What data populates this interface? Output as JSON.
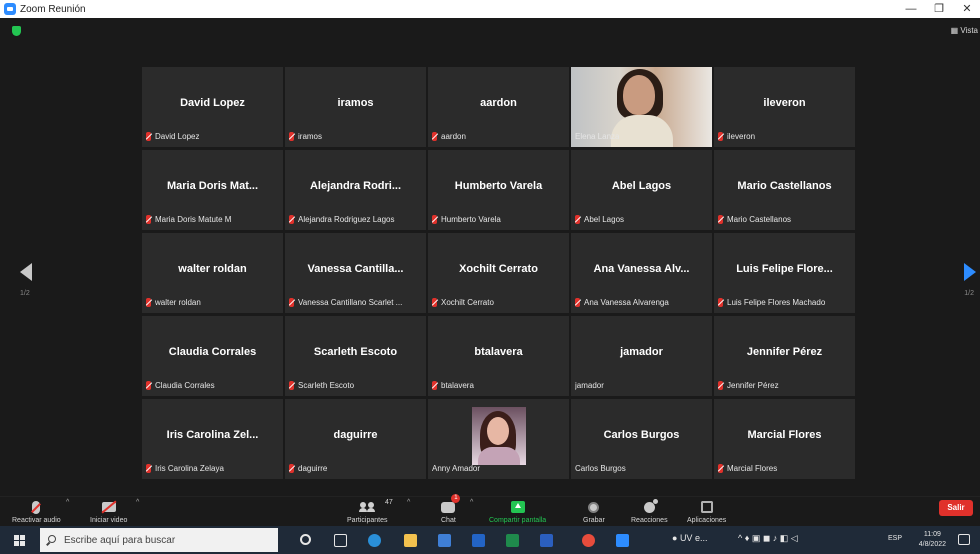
{
  "window": {
    "title": "Zoom Reunión",
    "minimize": "—",
    "maximize": "❐",
    "close": "✕"
  },
  "topbar": {
    "view_label": "Vista"
  },
  "pagination": {
    "left": "1/2",
    "right": "1/2"
  },
  "tiles": [
    {
      "big": "David Lopez",
      "label": "David Lopez",
      "muted": true
    },
    {
      "big": "iramos",
      "label": "iramos",
      "muted": true
    },
    {
      "big": "aardon",
      "label": "aardon",
      "muted": true
    },
    {
      "big": "",
      "label": "Elena Lanza",
      "muted": false,
      "video": "v1",
      "active": true
    },
    {
      "big": "ileveron",
      "label": "ileveron",
      "muted": true
    },
    {
      "big": "Maria Doris Mat...",
      "label": "Maria Doris Matute M",
      "muted": true
    },
    {
      "big": "Alejandra Rodri...",
      "label": "Alejandra Rodriguez Lagos",
      "muted": true
    },
    {
      "big": "Humberto Varela",
      "label": "Humberto Varela",
      "muted": true
    },
    {
      "big": "Abel Lagos",
      "label": "Abel Lagos",
      "muted": true
    },
    {
      "big": "Mario Castellanos",
      "label": "Mario Castellanos",
      "muted": true
    },
    {
      "big": "walter roldan",
      "label": "walter roldan",
      "muted": true
    },
    {
      "big": "Vanessa Cantilla...",
      "label": "Vanessa Cantillano Scarlet ...",
      "muted": true
    },
    {
      "big": "Xochilt Cerrato",
      "label": "Xochilt Cerrato",
      "muted": true
    },
    {
      "big": "Ana Vanessa Alv...",
      "label": "Ana Vanessa Alvarenga",
      "muted": true
    },
    {
      "big": "Luis Felipe Flore...",
      "label": "Luis Felipe Flores Machado",
      "muted": true
    },
    {
      "big": "Claudia Corrales",
      "label": "Claudia Corrales",
      "muted": true
    },
    {
      "big": "Scarleth Escoto",
      "label": "Scarleth Escoto",
      "muted": true
    },
    {
      "big": "btalavera",
      "label": "btalavera",
      "muted": true
    },
    {
      "big": "jamador",
      "label": "jamador",
      "muted": false
    },
    {
      "big": "Jennifer Pérez",
      "label": "Jennifer Pérez",
      "muted": true
    },
    {
      "big": "Iris Carolina Zel...",
      "label": "Iris Carolina Zelaya",
      "muted": true
    },
    {
      "big": "daguirre",
      "label": "daguirre",
      "muted": true
    },
    {
      "big": "",
      "label": "Anny Amador",
      "muted": false,
      "video": "v2"
    },
    {
      "big": "Carlos Burgos",
      "label": "Carlos Burgos",
      "muted": false
    },
    {
      "big": "Marcial Flores",
      "label": "Marcial Flores",
      "muted": true
    }
  ],
  "controls": {
    "audio": "Reactivar audio",
    "video": "Iniciar video",
    "participants": "Participantes",
    "participants_count": "47",
    "chat": "Chat",
    "chat_badge": "1",
    "share": "Compartir pantalla",
    "record": "Grabar",
    "reactions": "Reacciones",
    "apps": "Aplicaciones",
    "leave": "Salir"
  },
  "taskbar": {
    "search_placeholder": "Escribe aquí para buscar",
    "active_app": "UV e...",
    "lang": "ESP",
    "time": "11:09",
    "date": "4/8/2022"
  }
}
